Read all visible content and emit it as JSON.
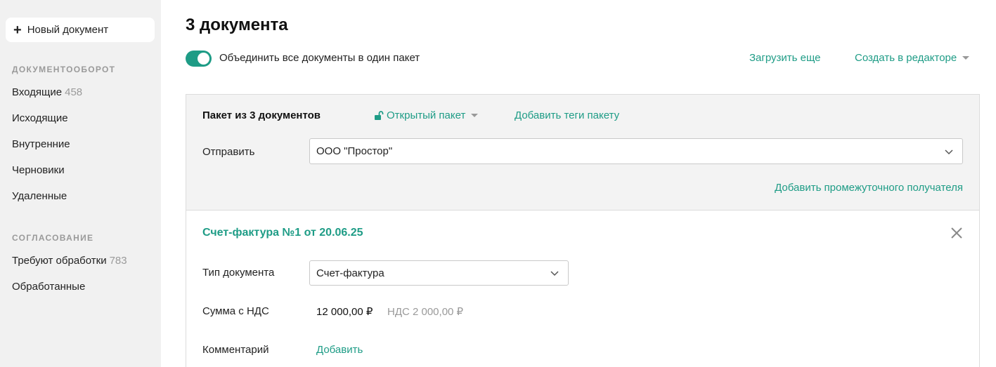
{
  "sidebar": {
    "new_doc_label": "Новый документ",
    "sections": [
      {
        "title": "ДОКУМЕНТООБОРОТ"
      },
      {
        "title": "СОГЛАСОВАНИЕ"
      }
    ],
    "items": [
      {
        "label": "Входящие",
        "count": "458"
      },
      {
        "label": "Исходящие"
      },
      {
        "label": "Внутренние"
      },
      {
        "label": "Черновики"
      },
      {
        "label": "Удаленные"
      },
      {
        "label": "Требуют обработки",
        "count": "783"
      },
      {
        "label": "Обработанные"
      }
    ]
  },
  "header": {
    "title": "3 документа",
    "merge_toggle_label": "Объединить все документы в один пакет",
    "merge_toggle_on": true,
    "load_more": "Загрузить еще",
    "create_in_editor": "Создать в редакторе"
  },
  "package": {
    "title": "Пакет из 3 документов",
    "access": "Открытый пакет",
    "add_tags": "Добавить теги пакету",
    "send_label": "Отправить",
    "recipient": "ООО \"Простор\"",
    "add_intermediate": "Добавить промежуточного получателя"
  },
  "document": {
    "title": "Счет-фактура №1 от 20.06.25",
    "type_label": "Тип документа",
    "type_value": "Счет-фактура",
    "sum_label": "Сумма с НДС",
    "sum_value": "12 000,00 ₽",
    "vat_value": "НДС 2 000,00 ₽",
    "comment_label": "Комментарий",
    "comment_add": "Добавить"
  },
  "colors": {
    "accent": "#1e9c86",
    "sidebar_bg": "#f1f1f1",
    "muted": "#9a9a9a"
  }
}
